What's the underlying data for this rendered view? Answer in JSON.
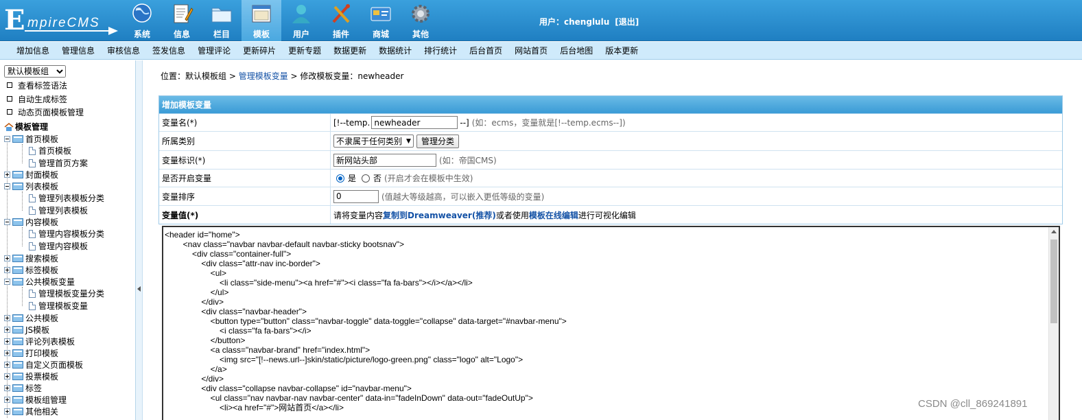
{
  "logo": {
    "big": "E",
    "rest": "mpireCMS"
  },
  "topnav": [
    {
      "label": "系统",
      "icon": "globe-icon"
    },
    {
      "label": "信息",
      "icon": "document-pencil-icon"
    },
    {
      "label": "栏目",
      "icon": "folder-icon"
    },
    {
      "label": "模板",
      "icon": "template-window-icon"
    },
    {
      "label": "用户",
      "icon": "user-icon"
    },
    {
      "label": "插件",
      "icon": "tools-icon"
    },
    {
      "label": "商城",
      "icon": "shop-card-icon"
    },
    {
      "label": "其他",
      "icon": "gear-icon"
    }
  ],
  "user": {
    "prefix": "用户：",
    "name": "chenglulu",
    "logout": "[退出]"
  },
  "subnav": [
    "增加信息",
    "管理信息",
    "审核信息",
    "签发信息",
    "管理评论",
    "更新碎片",
    "更新专题",
    "数据更新",
    "数据统计",
    "排行统计",
    "后台首页",
    "网站首页",
    "后台地图",
    "版本更新"
  ],
  "sidebar": {
    "group_select": "默认模板组",
    "quick": [
      "查看标签语法",
      "自动生成标签",
      "动态页面模板管理"
    ],
    "root": "模板管理",
    "tree": [
      {
        "label": "首页模板",
        "expanded": true,
        "children": [
          "首页模板",
          "管理首页方案"
        ]
      },
      {
        "label": "封面模板",
        "expanded": false
      },
      {
        "label": "列表模板",
        "expanded": true,
        "children": [
          "管理列表模板分类",
          "管理列表模板"
        ]
      },
      {
        "label": "内容模板",
        "expanded": true,
        "children": [
          "管理内容模板分类",
          "管理内容模板"
        ]
      },
      {
        "label": "搜索模板",
        "expanded": false
      },
      {
        "label": "标签模板",
        "expanded": false
      },
      {
        "label": "公共模板变量",
        "expanded": true,
        "children": [
          "管理模板变量分类",
          "管理模板变量"
        ]
      },
      {
        "label": "公共模板",
        "expanded": false
      },
      {
        "label": "JS模板",
        "expanded": false
      },
      {
        "label": "评论列表模板",
        "expanded": false
      },
      {
        "label": "打印模板",
        "expanded": false
      },
      {
        "label": "自定义页面模板",
        "expanded": false
      },
      {
        "label": "投票模板",
        "expanded": false
      },
      {
        "label": "标签",
        "expanded": false
      },
      {
        "label": "模板组管理",
        "expanded": false
      },
      {
        "label": "其他相关",
        "expanded": false
      }
    ]
  },
  "breadcrumb": {
    "prefix": "位置：默认模板组 > ",
    "link": "管理模板变量",
    "suffix": " > 修改模板变量：newheader"
  },
  "form": {
    "title": "增加模板变量",
    "var_name": {
      "label": "变量名(*)",
      "prefix": "[!--temp.",
      "value": "newheader",
      "suffix": "--]",
      "hint": "(如：ecms，变量就是[!--temp.ecms--])"
    },
    "category": {
      "label": "所属类别",
      "selected": "不隶属于任何类别",
      "button": "管理分类"
    },
    "var_title": {
      "label": "变量标识(*)",
      "value": "新网站头部",
      "hint": "(如：帝国CMS)"
    },
    "enabled": {
      "label": "是否开启变量",
      "yes": "是",
      "no": "否",
      "hint": "(开启才会在模板中生效)"
    },
    "order": {
      "label": "变量排序",
      "value": "0",
      "hint": "(值越大等级越高，可以嵌入更低等级的变量)"
    },
    "var_value": {
      "label": "变量值(*)",
      "t1": "请将变量内容",
      "l1": "复制到Dreamweaver(推荐)",
      "t2": "或者使用",
      "l2": "模板在线编辑",
      "t3": "进行可视化编辑"
    }
  },
  "code": "<header id=\"home\">\n        <nav class=\"navbar navbar-default navbar-sticky bootsnav\">\n            <div class=\"container-full\">\n                <div class=\"attr-nav inc-border\">\n                    <ul>\n                        <li class=\"side-menu\"><a href=\"#\"><i class=\"fa fa-bars\"></i></a></li>\n                    </ul>\n                </div>\n                <div class=\"navbar-header\">\n                    <button type=\"button\" class=\"navbar-toggle\" data-toggle=\"collapse\" data-target=\"#navbar-menu\">\n                        <i class=\"fa fa-bars\"></i>\n                    </button>\n                    <a class=\"navbar-brand\" href=\"index.html\">\n                        <img src=\"[!--news.url--]skin/static/picture/logo-green.png\" class=\"logo\" alt=\"Logo\">\n                    </a>\n                </div>\n                <div class=\"collapse navbar-collapse\" id=\"navbar-menu\">\n                    <ul class=\"nav navbar-nav navbar-center\" data-in=\"fadeInDown\" data-out=\"fadeOutUp\">\n                        <li><a href=\"#\">网站首页</a></li>",
  "watermark": "CSDN @cll_869241891",
  "colors": {
    "header": "#1f7fc2",
    "subnav": "#cfeafb",
    "form_head": "#3a9bd6",
    "link": "#1452a6"
  }
}
